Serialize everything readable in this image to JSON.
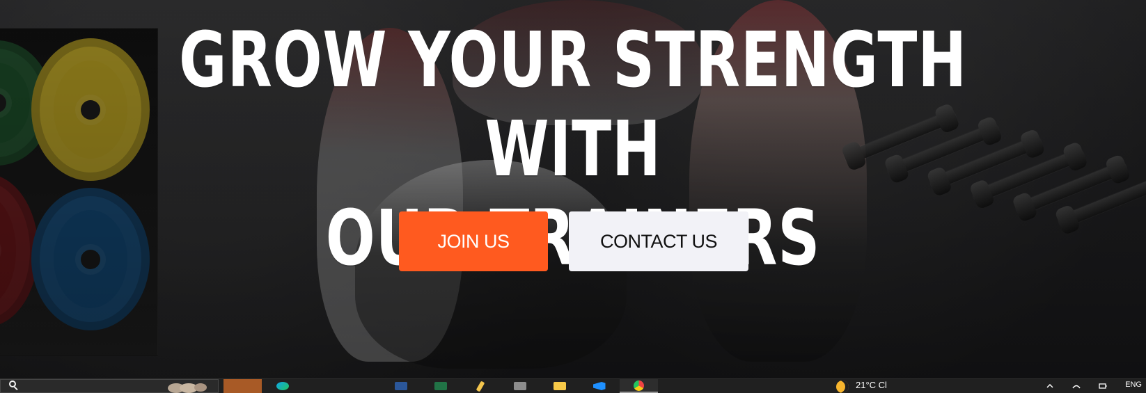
{
  "hero": {
    "title_line_1": "GROW YOUR STRENGTH WITH",
    "title_line_2": "OUR TRAINERS",
    "join_label": "JOIN US",
    "contact_label": "CONTACT US",
    "accent_color": "#ff5a1f",
    "secondary_button_color": "#f2f2f7"
  },
  "taskbar": {
    "search_icon": "search-icon",
    "weather_text": "21°C",
    "weather_condition": "Cl",
    "language": "ENG",
    "apps": [
      {
        "name": "orange-app-icon",
        "color": "#a85a26"
      },
      {
        "name": "edge-icon",
        "color": "#0ea5e9"
      },
      {
        "name": "word-icon",
        "color": "#2b579a"
      },
      {
        "name": "excel-icon",
        "color": "#217346"
      },
      {
        "name": "pencil-icon",
        "color": "#f3c54d"
      },
      {
        "name": "app-icon",
        "color": "#8c8c8c"
      },
      {
        "name": "folder-icon",
        "color": "#f7c948"
      },
      {
        "name": "vscode-icon",
        "color": "#1e90ff"
      },
      {
        "name": "chrome-icon",
        "color": "#ef4444"
      }
    ]
  }
}
